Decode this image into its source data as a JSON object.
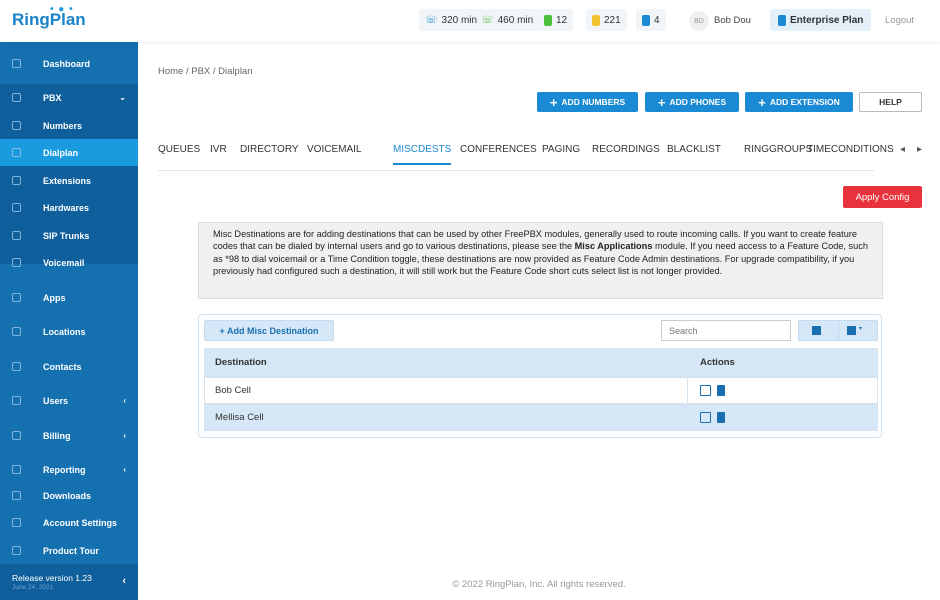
{
  "brand": "RingPlan",
  "header": {
    "minutes_in": "320 min",
    "minutes_out": "460 min",
    "count_green": "12",
    "count_yellow": "221",
    "count_blue": "4",
    "user_initials": "BD",
    "user_name": "Bob Dou",
    "plan": "Enterprise Plan",
    "logout": "Logout"
  },
  "sidebar": {
    "items": [
      {
        "label": "Dashboard"
      },
      {
        "label": "PBX"
      },
      {
        "label": "Numbers"
      },
      {
        "label": "Dialplan"
      },
      {
        "label": "Extensions"
      },
      {
        "label": "Hardwares"
      },
      {
        "label": "SIP Trunks"
      },
      {
        "label": "Voicemail"
      },
      {
        "label": "Apps"
      },
      {
        "label": "Locations"
      },
      {
        "label": "Contacts"
      },
      {
        "label": "Users"
      },
      {
        "label": "Billing"
      },
      {
        "label": "Reporting"
      },
      {
        "label": "Downloads"
      },
      {
        "label": "Account Settings"
      },
      {
        "label": "Product Tour"
      }
    ],
    "release": "Release version 1.23",
    "release_date": "June 24, 2021"
  },
  "breadcrumb": "Home / PBX / Dialplan",
  "actions": {
    "add_numbers": "ADD NUMBERS",
    "add_phones": "ADD PHONES",
    "add_extension": "ADD EXTENSION",
    "help": "HELP",
    "apply": "Apply Config"
  },
  "tabs": [
    "QUEUES",
    "IVR",
    "DIRECTORY",
    "VOICEMAIL",
    "MISCDESTS",
    "CONFERENCES",
    "PAGING",
    "RECORDINGS",
    "BLACKLIST",
    "RINGGROUPS",
    "TIMECONDITIONS"
  ],
  "info": {
    "before": "Misc Destinations are for adding destinations that can be used by other FreePBX modules, generally used to route incoming calls. If you want to create feature codes that can be dialed by internal users and go to various destinations, please see the ",
    "bold": "Misc Applications",
    "after": " module. If you need access to a Feature Code, such as *98 to dial voicemail or a Time Condition toggle, these destinations are now provided as Feature Code Admin destinations. For upgrade compatibility, if you previously had configured such a destination, it will still work but the Feature Code short cuts select list is not longer provided."
  },
  "table": {
    "add_label": "+ Add Misc Destination",
    "search_placeholder": "Search",
    "columns": [
      "Destination",
      "Actions"
    ],
    "rows": [
      {
        "destination": "Bob Cell"
      },
      {
        "destination": "Mellisa Cell"
      }
    ]
  },
  "footer": "© 2022 RingPlan, Inc. All rights reserved.",
  "colors": {
    "sidebar": "#1570b0",
    "active": "#1a9be0",
    "primary": "#1a8ad4",
    "apply": "#e8323c"
  }
}
